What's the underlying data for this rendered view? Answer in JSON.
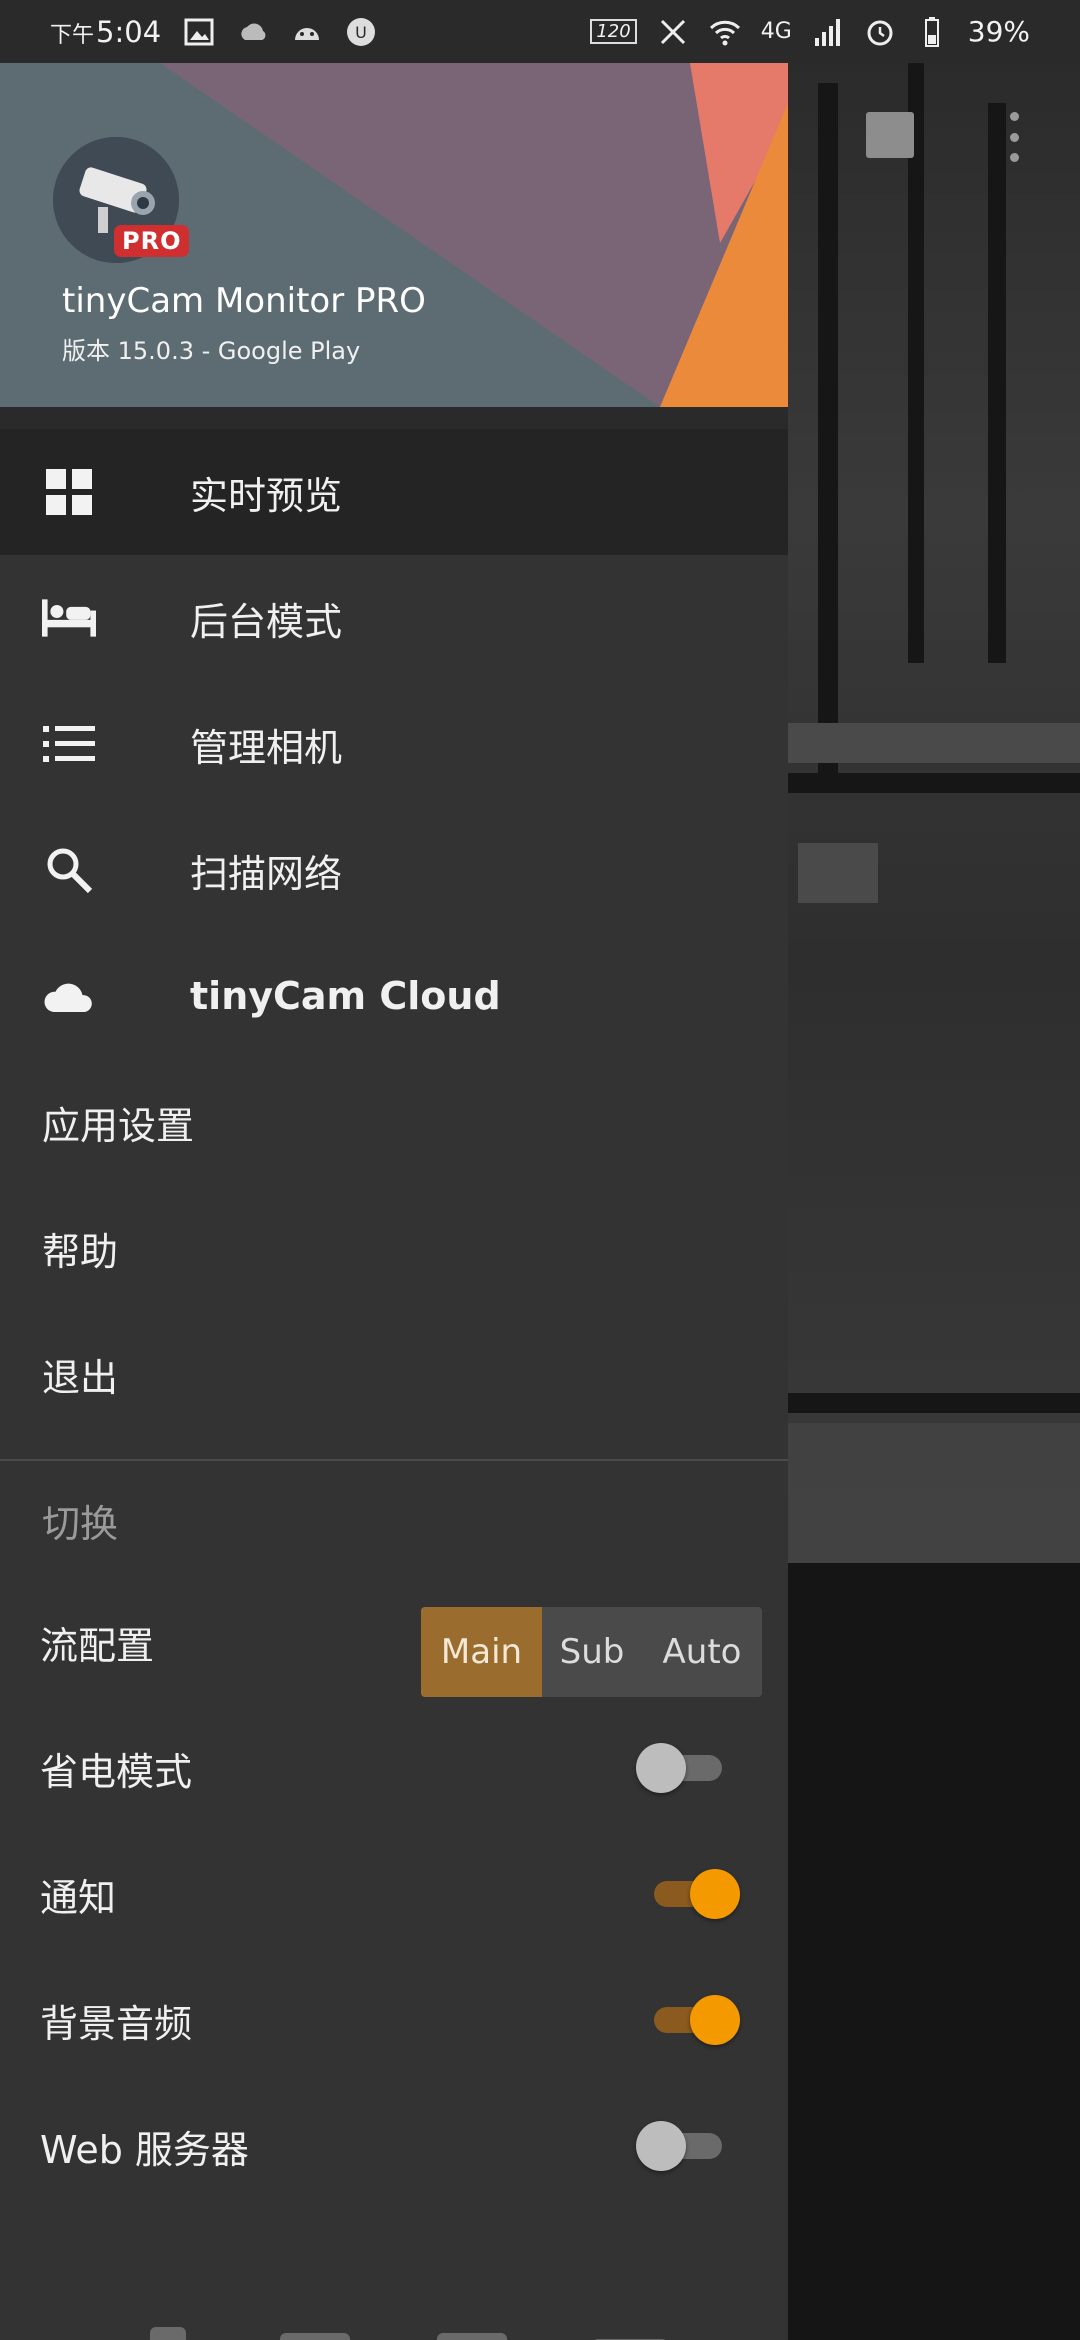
{
  "status_bar": {
    "time_prefix": "下午",
    "time": "5:04",
    "refresh_rate": "120",
    "network": "4G",
    "battery": "39%"
  },
  "header": {
    "app_name": "tinyCam Monitor PRO",
    "version": "版本 15.0.3 - Google Play",
    "badge": "PRO"
  },
  "menu": {
    "items": [
      {
        "label": "实时预览",
        "icon": "grid-icon",
        "active": true
      },
      {
        "label": "后台模式",
        "icon": "bed-icon"
      },
      {
        "label": "管理相机",
        "icon": "list-icon"
      },
      {
        "label": "扫描网络",
        "icon": "search-icon"
      },
      {
        "label": "tinyCam Cloud",
        "icon": "cloud-icon"
      }
    ],
    "plain_items": [
      {
        "label": "应用设置"
      },
      {
        "label": "帮助"
      },
      {
        "label": "退出"
      }
    ]
  },
  "toggles_section": {
    "header": "切换",
    "stream": {
      "label": "流配置",
      "options": [
        "Main",
        "Sub",
        "Auto"
      ],
      "selected": "Main"
    },
    "power_save": {
      "label": "省电模式",
      "on": false
    },
    "notification": {
      "label": "通知",
      "on": true
    },
    "bg_audio": {
      "label": "背景音频",
      "on": true
    },
    "web_server": {
      "label": "Web 服务器",
      "on": false
    }
  },
  "colors": {
    "accent": "#f49a00",
    "segment_selected": "#9a6d2e",
    "drawer_bg": "#333333"
  }
}
